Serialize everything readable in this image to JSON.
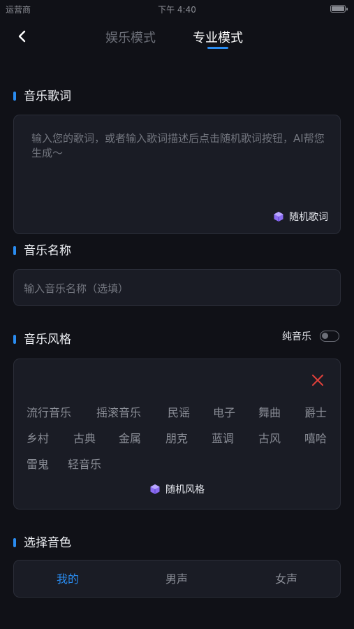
{
  "status_bar": {
    "carrier": "运营商",
    "time": "下午 4:40"
  },
  "tabs": [
    {
      "label": "娱乐模式"
    },
    {
      "label": "专业模式"
    }
  ],
  "lyrics": {
    "title": "音乐歌词",
    "placeholder": "输入您的歌词，或者输入歌词描述后点击随机歌词按钮，AI帮您生成～",
    "random_label": "随机歌词"
  },
  "music_name": {
    "title": "音乐名称",
    "placeholder": "输入音乐名称（选填）"
  },
  "music_style": {
    "title": "音乐风格",
    "pure_music_label": "纯音乐",
    "pure_music_on": false,
    "styles": [
      "流行音乐",
      "摇滚音乐",
      "民谣",
      "电子",
      "舞曲",
      "爵士",
      "乡村",
      "古典",
      "金属",
      "朋克",
      "蓝调",
      "古风",
      "嘻哈",
      "雷鬼",
      "轻音乐"
    ],
    "random_label": "随机风格"
  },
  "voice": {
    "title": "选择音色",
    "tabs": [
      "我的",
      "男声",
      "女声"
    ],
    "active_tab": "我的"
  },
  "colors": {
    "accent": "#2a8cf0",
    "background": "#101117",
    "card": "#1a1c25",
    "close_red": "#e0403a",
    "cube_purple": "#8b6cf2"
  }
}
